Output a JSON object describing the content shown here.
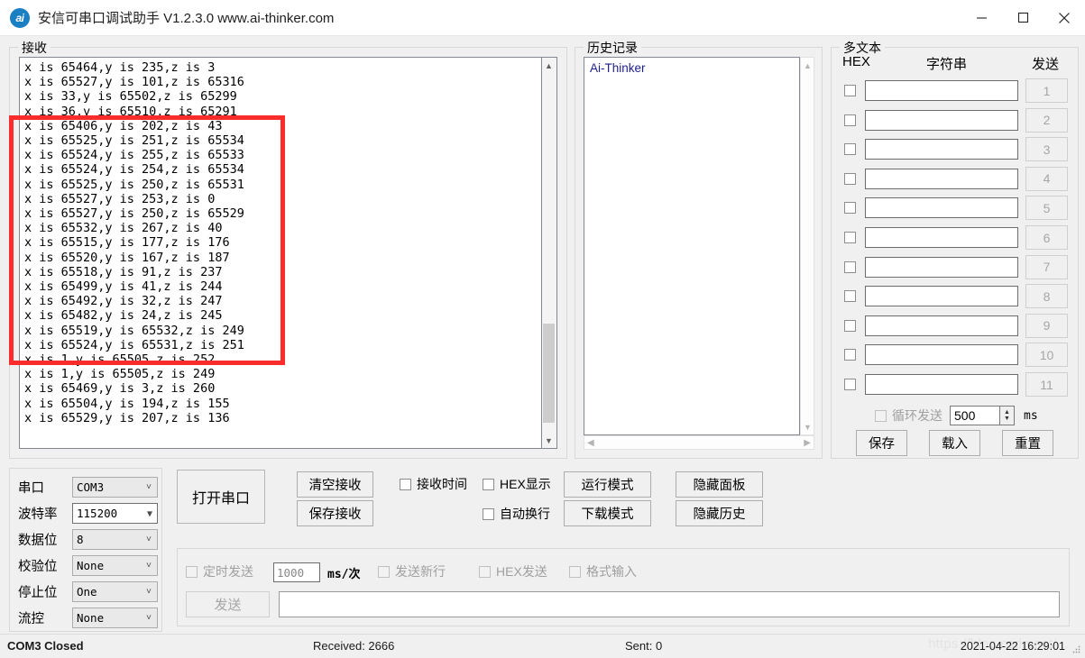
{
  "window": {
    "logo_text": "ai",
    "title": "安信可串口调试助手 V1.2.3.0   www.ai-thinker.com",
    "minimize_icon": "minimize-icon",
    "maximize_icon": "maximize-icon",
    "close_icon": "close-icon"
  },
  "receive": {
    "group_label": "接收",
    "lines": [
      "x is 65464,y is 235,z is 3",
      "x is 65527,y is 101,z is 65316",
      "x is 33,y is 65502,z is 65299",
      "x is 36,y is 65510,z is 65291",
      "x is 65406,y is 202,z is 43",
      "x is 65525,y is 251,z is 65534",
      "x is 65524,y is 255,z is 65533",
      "x is 65524,y is 254,z is 65534",
      "x is 65525,y is 250,z is 65531",
      "x is 65527,y is 253,z is 0",
      "x is 65527,y is 250,z is 65529",
      "x is 65532,y is 267,z is 40",
      "x is 65515,y is 177,z is 176",
      "x is 65520,y is 167,z is 187",
      "x is 65518,y is 91,z is 237",
      "x is 65499,y is 41,z is 244",
      "x is 65492,y is 32,z is 247",
      "x is 65482,y is 24,z is 245",
      "x is 65519,y is 65532,z is 249",
      "x is 65524,y is 65531,z is 251",
      "x is 1,y is 65505,z is 252",
      "x is 1,y is 65505,z is 249",
      "x is 65469,y is 3,z is 260",
      "x is 65504,y is 194,z is 155",
      "x is 65529,y is 207,z is 136"
    ],
    "annotation_color": "#fb2c2c"
  },
  "history": {
    "group_label": "历史记录",
    "items": [
      "Ai-Thinker"
    ]
  },
  "multitext": {
    "group_label": "多文本",
    "col_hex": "HEX",
    "col_string": "字符串",
    "col_send": "发送",
    "rows": [
      {
        "num": "1",
        "value": ""
      },
      {
        "num": "2",
        "value": ""
      },
      {
        "num": "3",
        "value": ""
      },
      {
        "num": "4",
        "value": ""
      },
      {
        "num": "5",
        "value": ""
      },
      {
        "num": "6",
        "value": ""
      },
      {
        "num": "7",
        "value": ""
      },
      {
        "num": "8",
        "value": ""
      },
      {
        "num": "9",
        "value": ""
      },
      {
        "num": "10",
        "value": ""
      },
      {
        "num": "11",
        "value": ""
      }
    ],
    "loop_label": "循环发送",
    "loop_value": "500",
    "loop_unit": "ms",
    "save_label": "保存",
    "load_label": "载入",
    "reset_label": "重置"
  },
  "serial": {
    "rows": [
      {
        "label": "串口",
        "value": "COM3"
      },
      {
        "label": "波特率",
        "value": "115200"
      },
      {
        "label": "数据位",
        "value": "8"
      },
      {
        "label": "校验位",
        "value": "None"
      },
      {
        "label": "停止位",
        "value": "One"
      },
      {
        "label": "流控",
        "value": "None"
      }
    ],
    "open_button": "打开串口"
  },
  "controls": {
    "clear_recv": "清空接收",
    "save_recv": "保存接收",
    "recv_time": "接收时间",
    "hex_display": "HEX显示",
    "auto_wrap": "自动换行",
    "run_mode": "运行模式",
    "download_mode": "下载模式",
    "hide_panel": "隐藏面板",
    "hide_history": "隐藏历史"
  },
  "send": {
    "timed_label": "定时发送",
    "timed_value": "1000",
    "timed_unit": "ms/次",
    "newline_label": "发送新行",
    "hex_label": "HEX发送",
    "format_label": "格式输入",
    "send_button": "发送",
    "input_value": ""
  },
  "status": {
    "port": "COM3 Closed",
    "received": "Received: 2666",
    "sent": "Sent: 0",
    "timestamp": "2021-04-22 16:29:01",
    "watermark": "https://blog.csdn.net/..."
  }
}
